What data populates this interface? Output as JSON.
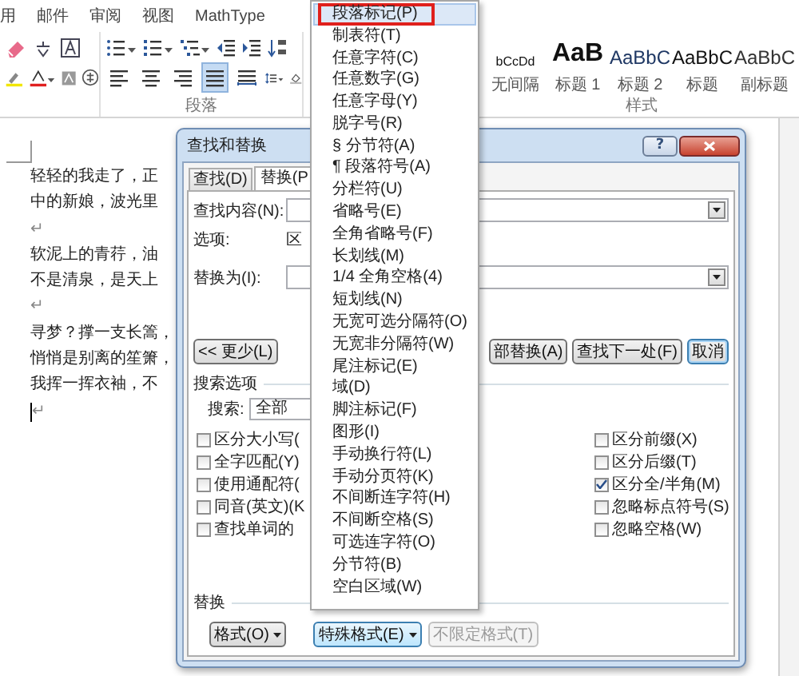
{
  "ribbon": {
    "tabs": [
      "用",
      "邮件",
      "审阅",
      "视图",
      "MathType"
    ],
    "align_buttons": [
      {
        "kind": "left",
        "selected": false
      },
      {
        "kind": "center",
        "selected": false
      },
      {
        "kind": "right",
        "selected": false
      },
      {
        "kind": "justify",
        "selected": true
      },
      {
        "kind": "distributed",
        "selected": false
      }
    ],
    "paragraph_group": "段落",
    "styles_group": "样式",
    "styles": [
      {
        "sample": "bCcDd",
        "name": "无间隔",
        "kind": "compact"
      },
      {
        "sample": "AaB",
        "name": "标题 1",
        "kind": "heading1"
      },
      {
        "sample": "AaBbC",
        "name": "标题 2",
        "kind": "heading2"
      },
      {
        "sample": "AaBbC",
        "name": "标题",
        "kind": "title"
      },
      {
        "sample": "AaBbC",
        "name": "副标题",
        "kind": "subtitle"
      }
    ]
  },
  "document": {
    "lines": [
      {
        "kind": "text",
        "text": "轻轻的我走了，正"
      },
      {
        "kind": "text",
        "text": "中的新娘，波光里"
      },
      {
        "kind": "mark",
        "text": "↵"
      },
      {
        "kind": "text",
        "text": "软泥上的青荇，油"
      },
      {
        "kind": "text",
        "text": "不是清泉，是天上"
      },
      {
        "kind": "mark",
        "text": "↵"
      },
      {
        "kind": "text",
        "text": "寻梦？撑一支长篙，"
      },
      {
        "kind": "text",
        "text": "悄悄是别离的笙箫，"
      },
      {
        "kind": "text",
        "text": "我挥一挥衣袖，不"
      },
      {
        "kind": "cursor",
        "text": "↵"
      }
    ]
  },
  "dialog": {
    "title": "查找和替换",
    "help": "?",
    "tabs": [
      {
        "label": "查找(D)",
        "selected": false
      },
      {
        "label": "替换(P",
        "selected": true
      }
    ],
    "find_label": "查找内容(N):",
    "options_label": "选项:",
    "options_value": "区",
    "replace_label": "替换为(I):",
    "less_button": "<< 更少(L)",
    "actions": [
      {
        "label": "部替换(A)",
        "kind": "normal"
      },
      {
        "label": "查找下一处(F)",
        "kind": "normal"
      },
      {
        "label": "取消",
        "kind": "default"
      }
    ],
    "search_options_title": "搜索选项",
    "search_label": "搜索:",
    "search_value": "全部",
    "checks_left": [
      {
        "label": "区分大小写(",
        "checked": false
      },
      {
        "label": "全字匹配(Y)",
        "checked": false
      },
      {
        "label": "使用通配符(",
        "checked": false
      },
      {
        "label": "同音(英文)(K",
        "checked": false
      },
      {
        "label": "查找单词的",
        "checked": false
      }
    ],
    "checks_right": [
      {
        "label": "区分前缀(X)",
        "checked": false
      },
      {
        "label": "区分后缀(T)",
        "checked": false
      },
      {
        "label": "区分全/半角(M)",
        "checked": true
      },
      {
        "label": "忽略标点符号(S)",
        "checked": false
      },
      {
        "label": "忽略空格(W)",
        "checked": false
      }
    ],
    "replace_title": "替换",
    "bottom_buttons": [
      {
        "label": "格式(O)",
        "dropdown": true,
        "pressed": false,
        "disabled": false
      },
      {
        "label": "特殊格式(E)",
        "dropdown": true,
        "pressed": true,
        "disabled": false
      },
      {
        "label": "不限定格式(T)",
        "dropdown": false,
        "pressed": false,
        "disabled": true
      }
    ]
  },
  "menu": {
    "items": [
      {
        "label": "段落标记(P)",
        "selected": true
      },
      {
        "label": "制表符(T)",
        "selected": false
      },
      {
        "label": "任意字符(C)",
        "selected": false
      },
      {
        "label": "任意数字(G)",
        "selected": false
      },
      {
        "label": "任意字母(Y)",
        "selected": false
      },
      {
        "label": "脱字号(R)",
        "selected": false
      },
      {
        "label": "§ 分节符(A)",
        "selected": false
      },
      {
        "label": "¶ 段落符号(A)",
        "selected": false
      },
      {
        "label": "分栏符(U)",
        "selected": false
      },
      {
        "label": "省略号(E)",
        "selected": false
      },
      {
        "label": "全角省略号(F)",
        "selected": false
      },
      {
        "label": "长划线(M)",
        "selected": false
      },
      {
        "label": "1/4 全角空格(4)",
        "selected": false
      },
      {
        "label": "短划线(N)",
        "selected": false
      },
      {
        "label": "无宽可选分隔符(O)",
        "selected": false
      },
      {
        "label": "无宽非分隔符(W)",
        "selected": false
      },
      {
        "label": "尾注标记(E)",
        "selected": false
      },
      {
        "label": "域(D)",
        "selected": false
      },
      {
        "label": "脚注标记(F)",
        "selected": false
      },
      {
        "label": "图形(I)",
        "selected": false
      },
      {
        "label": "手动换行符(L)",
        "selected": false
      },
      {
        "label": "手动分页符(K)",
        "selected": false
      },
      {
        "label": "不间断连字符(H)",
        "selected": false
      },
      {
        "label": "不间断空格(S)",
        "selected": false
      },
      {
        "label": "可选连字符(O)",
        "selected": false
      },
      {
        "label": "分节符(B)",
        "selected": false
      },
      {
        "label": "空白区域(W)",
        "selected": false
      }
    ]
  }
}
